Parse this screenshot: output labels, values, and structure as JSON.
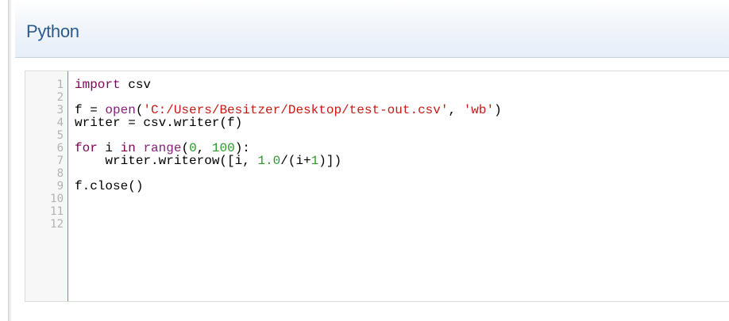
{
  "panel": {
    "title": "Python"
  },
  "code": {
    "line_numbers": [
      "1",
      "2",
      "3",
      "4",
      "5",
      "6",
      "7",
      "8",
      "9",
      "10",
      "11",
      "12"
    ],
    "lines": [
      [
        {
          "t": "import",
          "c": "kw"
        },
        {
          "t": " csv",
          "c": ""
        }
      ],
      [],
      [
        {
          "t": "f = ",
          "c": ""
        },
        {
          "t": "open",
          "c": "bi"
        },
        {
          "t": "(",
          "c": ""
        },
        {
          "t": "'C:/Users/Besitzer/Desktop/test-out.csv'",
          "c": "str"
        },
        {
          "t": ", ",
          "c": ""
        },
        {
          "t": "'wb'",
          "c": "str"
        },
        {
          "t": ")",
          "c": ""
        }
      ],
      [
        {
          "t": "writer = csv.writer(f)",
          "c": ""
        }
      ],
      [],
      [
        {
          "t": "for",
          "c": "kw"
        },
        {
          "t": " i ",
          "c": ""
        },
        {
          "t": "in",
          "c": "kw"
        },
        {
          "t": " ",
          "c": ""
        },
        {
          "t": "range",
          "c": "bi"
        },
        {
          "t": "(",
          "c": ""
        },
        {
          "t": "0",
          "c": "num"
        },
        {
          "t": ", ",
          "c": ""
        },
        {
          "t": "100",
          "c": "num"
        },
        {
          "t": "):",
          "c": ""
        }
      ],
      [
        {
          "t": "    writer.writerow([i, ",
          "c": ""
        },
        {
          "t": "1.0",
          "c": "num"
        },
        {
          "t": "/(i+",
          "c": ""
        },
        {
          "t": "1",
          "c": "num"
        },
        {
          "t": ")])",
          "c": ""
        }
      ],
      [],
      [
        {
          "t": "f.close()",
          "c": ""
        }
      ],
      [],
      [],
      []
    ]
  },
  "colors": {
    "title": "#2c5a8c",
    "keyword": "#7f0055",
    "builtin": "#8a1d7a",
    "string": "#c41a16",
    "number": "#2a9a2a",
    "gutter_border": "#6fa35d",
    "line_number": "#b2b2b2"
  }
}
